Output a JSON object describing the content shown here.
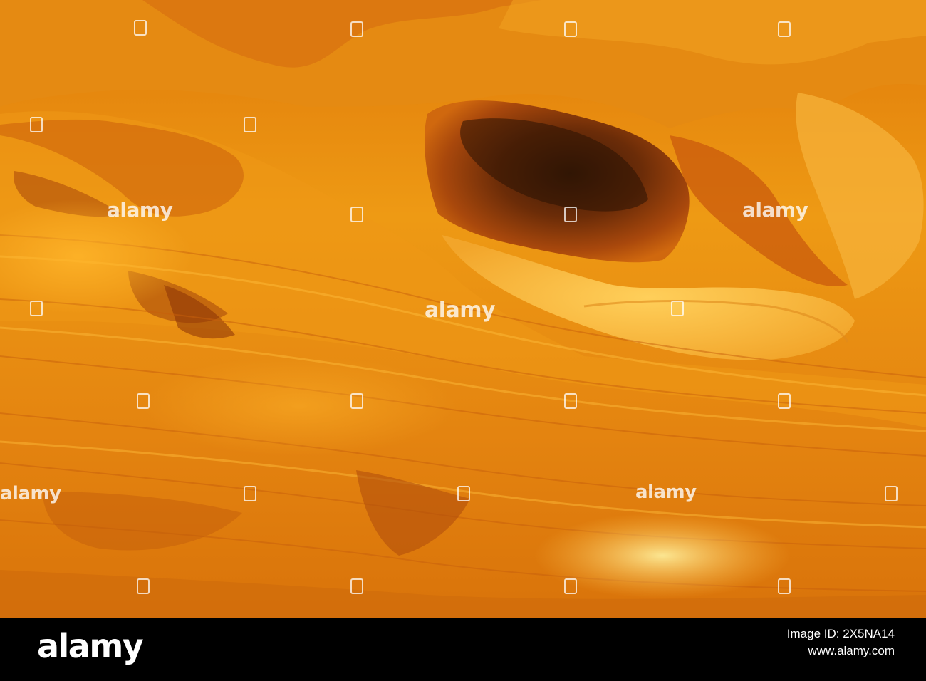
{
  "photo": {
    "subject": "orange sandstone cave wall"
  },
  "watermark": {
    "text": "alamy"
  },
  "footer": {
    "logo_text": "alamy",
    "image_id_label": "Image ID: 2X5NA14",
    "site": "www.alamy.com"
  }
}
